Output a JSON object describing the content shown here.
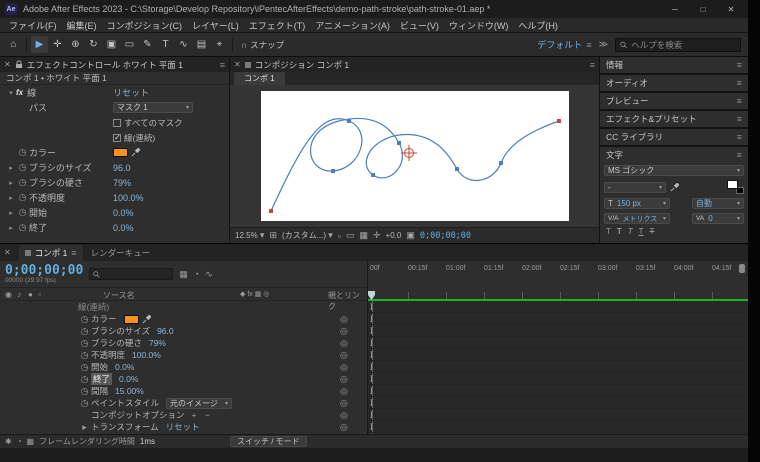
{
  "icons": {
    "close": "✕",
    "menu": "≡",
    "caret": "▾",
    "chevron_right": "▸",
    "chevron_down": "▾",
    "stopwatch": "◷",
    "pick_whip": "◎",
    "overflow": "≫",
    "snap": "∩",
    "minimize": "─",
    "maximize": "□",
    "eye": "◉",
    "audio": "♪",
    "solo": "●",
    "lock": "▫",
    "switches": "◆ fx ▦ ◎",
    "flowchart": "▦",
    "draft": "◔",
    "graph": "∿",
    "grid": "⊞",
    "transparency": "▫",
    "roi": "▭",
    "mask": "▦",
    "target": "✛",
    "camera": "▣",
    "meter_a": "✱",
    "meter_b": "◔",
    "meter_c": "▦",
    "app": "Ae"
  },
  "titlebar": {
    "title": "Adobe After Effects 2023 - C:\\Storage\\Develop Repository\\iPentecAfterEffects\\demo-path-stroke\\path-stroke-01.aep *"
  },
  "menu": {
    "items": [
      "ファイル(F)",
      "編集(E)",
      "コンポジション(C)",
      "レイヤー(L)",
      "エフェクト(T)",
      "アニメーション(A)",
      "ビュー(V)",
      "ウィンドウ(W)",
      "ヘルプ(H)"
    ]
  },
  "toolbar": {
    "tools": [
      {
        "name": "home-tool",
        "glyph": "⌂"
      },
      {
        "name": "selection-tool",
        "glyph": "▶"
      },
      {
        "name": "hand-tool",
        "glyph": "✛"
      },
      {
        "name": "zoom-tool",
        "glyph": "⊕"
      },
      {
        "name": "orbit-camera-tool",
        "glyph": "↻"
      },
      {
        "name": "camera-tool",
        "glyph": "▣"
      },
      {
        "name": "rectangle-tool",
        "glyph": "▭"
      },
      {
        "name": "pen-tool",
        "glyph": "✎"
      },
      {
        "name": "type-tool",
        "glyph": "T"
      },
      {
        "name": "brush-tool",
        "glyph": "∿"
      },
      {
        "name": "clone-stamp-tool",
        "glyph": "▤"
      },
      {
        "name": "puppet-tool",
        "glyph": "⌖"
      }
    ],
    "snap_label": "スナップ",
    "workspace_label": "デフォルト",
    "search_placeholder": "ヘルプを検索"
  },
  "effect_controls": {
    "tab_title": "エフェクトコントロール ホワイト 平面 1",
    "breadcrumb": "コンポ 1 • ホワイト 平面 1",
    "effect_name": "線",
    "reset": "リセット",
    "path_label": "パス",
    "path_value": "マスク 1",
    "all_masks": {
      "label": "すべてのマスク",
      "checked": false
    },
    "stroke_seq": {
      "label": "線(連続)",
      "checked": true
    },
    "props": [
      {
        "label": "カラー",
        "color": "#f7941d"
      },
      {
        "label": "ブラシのサイズ",
        "value": "96.0"
      },
      {
        "label": "ブラシの硬さ",
        "value": "79%"
      },
      {
        "label": "不透明度",
        "value": "100.0%"
      },
      {
        "label": "開始",
        "value": "0.0%"
      },
      {
        "label": "終了",
        "value": "0.0%"
      }
    ]
  },
  "composition": {
    "tab_title": "コンポジション コンポ 1",
    "viewer_tab": "コンポ 1",
    "zoom": "12.5%",
    "resolution": "(カスタム...)",
    "exposure": "+0.0",
    "timecode": "0;00;00;00",
    "path_color": "#4a7fbb",
    "marker_red": "#cc4433"
  },
  "right_panels": {
    "panels": [
      "情報",
      "オーディオ",
      "プレビュー",
      "エフェクト&プリセット",
      "CC ライブラリ"
    ]
  },
  "character": {
    "title": "文字",
    "font_family": "MS ゴシック",
    "font_style": "-",
    "size_icon": "T",
    "font_size": "150 px",
    "leading": "自動",
    "kerning_icon": "V/A",
    "kerning": "メトリクス",
    "tracking_icon": "VA",
    "tracking": "0"
  },
  "timeline": {
    "comp_tab": "コンポ 1",
    "render_queue_tab": "レンダーキュー",
    "timecode": "0;00;00;00",
    "frame_info": "00000 (29.97 fps)",
    "source_name_col": "ソース名",
    "parent_col": "親とリンク",
    "rows": [
      {
        "label": "線(連続)",
        "value": ""
      },
      {
        "label": "カラー",
        "value": "",
        "color": "#f7941d"
      },
      {
        "label": "ブラシのサイズ",
        "value": "96.0"
      },
      {
        "label": "ブラシの硬さ",
        "value": "79%"
      },
      {
        "label": "不透明度",
        "value": "100.0%"
      },
      {
        "label": "開始",
        "value": "0.0%"
      },
      {
        "label": "終了",
        "value": "0.0%"
      },
      {
        "label": "間隔",
        "value": "15.00%"
      },
      {
        "label": "ペイントスタイル",
        "value": "元のイメージ"
      },
      {
        "label": "コンポジットオプション",
        "value": "+ −"
      },
      {
        "label": "トランスフォーム",
        "value": "リセット"
      }
    ],
    "ruler": [
      "00f",
      "00:15f",
      "01:00f",
      "01:15f",
      "02:00f",
      "02:15f",
      "03:00f",
      "03:15f",
      "04:00f",
      "04:15f"
    ],
    "footer": {
      "render_label": "フレームレンダリング時間",
      "render_value": "1ms",
      "switches": "スイッチ / モード"
    }
  }
}
